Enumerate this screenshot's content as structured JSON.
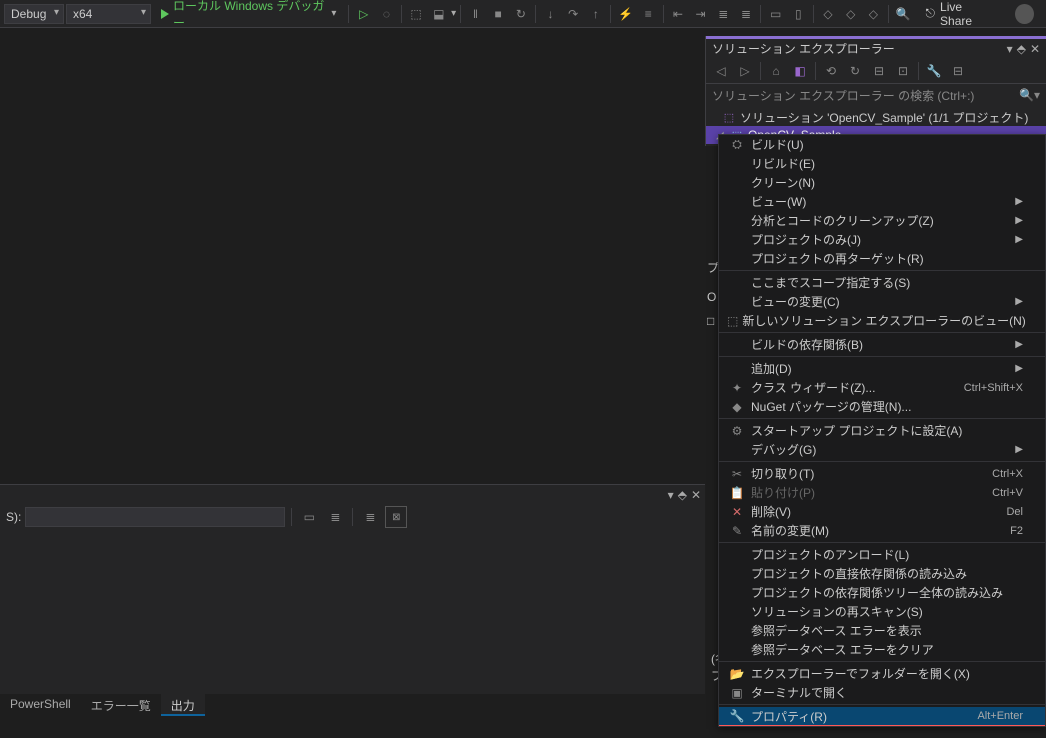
{
  "toolbar": {
    "config": "Debug",
    "platform": "x64",
    "debugger_label": "ローカル Windows デバッガー",
    "live_share": "Live Share"
  },
  "solution_explorer": {
    "title": "ソリューション エクスプローラー",
    "search_placeholder": "ソリューション エクスプローラー の検索 (Ctrl+:)",
    "tree": {
      "solution": "ソリューション 'OpenCV_Sample' (1/1 プロジェクト)",
      "project": "OpenCV_Sample"
    }
  },
  "properties_stub": {
    "line1": "プ",
    "line2": "O",
    "line3": "□"
  },
  "output_panel": {
    "label": "S):"
  },
  "bottom_row_stub": {
    "line1": "(名",
    "line2": "プ"
  },
  "bottom_tabs": {
    "powershell": "PowerShell",
    "error_list": "エラー一覧",
    "output": "出力"
  },
  "context_menu": [
    {
      "icon": "build",
      "label": "ビルド(U)"
    },
    {
      "label": "リビルド(E)"
    },
    {
      "label": "クリーン(N)"
    },
    {
      "label": "ビュー(W)",
      "submenu": true
    },
    {
      "label": "分析とコードのクリーンアップ(Z)",
      "submenu": true
    },
    {
      "label": "プロジェクトのみ(J)",
      "submenu": true
    },
    {
      "label": "プロジェクトの再ターゲット(R)"
    },
    {
      "sep": true
    },
    {
      "label": "ここまでスコープ指定する(S)"
    },
    {
      "label": "ビューの変更(C)",
      "submenu": true
    },
    {
      "icon": "newview",
      "label": "新しいソリューション エクスプローラーのビュー(N)"
    },
    {
      "sep": true
    },
    {
      "label": "ビルドの依存関係(B)",
      "submenu": true
    },
    {
      "sep": true
    },
    {
      "label": "追加(D)",
      "submenu": true
    },
    {
      "icon": "wizard",
      "label": "クラス ウィザード(Z)...",
      "shortcut": "Ctrl+Shift+X"
    },
    {
      "icon": "nuget",
      "label": "NuGet パッケージの管理(N)..."
    },
    {
      "sep": true
    },
    {
      "icon": "gear",
      "label": "スタートアップ プロジェクトに設定(A)"
    },
    {
      "label": "デバッグ(G)",
      "submenu": true
    },
    {
      "sep": true
    },
    {
      "icon": "cut",
      "label": "切り取り(T)",
      "shortcut": "Ctrl+X"
    },
    {
      "icon": "paste",
      "label": "貼り付け(P)",
      "shortcut": "Ctrl+V",
      "disabled": true
    },
    {
      "icon": "delete",
      "label": "削除(V)",
      "shortcut": "Del"
    },
    {
      "icon": "rename",
      "label": "名前の変更(M)",
      "shortcut": "F2"
    },
    {
      "sep": true
    },
    {
      "label": "プロジェクトのアンロード(L)"
    },
    {
      "label": "プロジェクトの直接依存関係の読み込み"
    },
    {
      "label": "プロジェクトの依存関係ツリー全体の読み込み"
    },
    {
      "label": "ソリューションの再スキャン(S)"
    },
    {
      "label": "参照データベース エラーを表示"
    },
    {
      "label": "参照データベース エラーをクリア"
    },
    {
      "sep": true
    },
    {
      "icon": "folder",
      "label": "エクスプローラーでフォルダーを開く(X)"
    },
    {
      "icon": "terminal",
      "label": "ターミナルで開く"
    },
    {
      "sep": true
    },
    {
      "icon": "wrench",
      "label": "プロパティ(R)",
      "shortcut": "Alt+Enter",
      "selected": true
    }
  ]
}
